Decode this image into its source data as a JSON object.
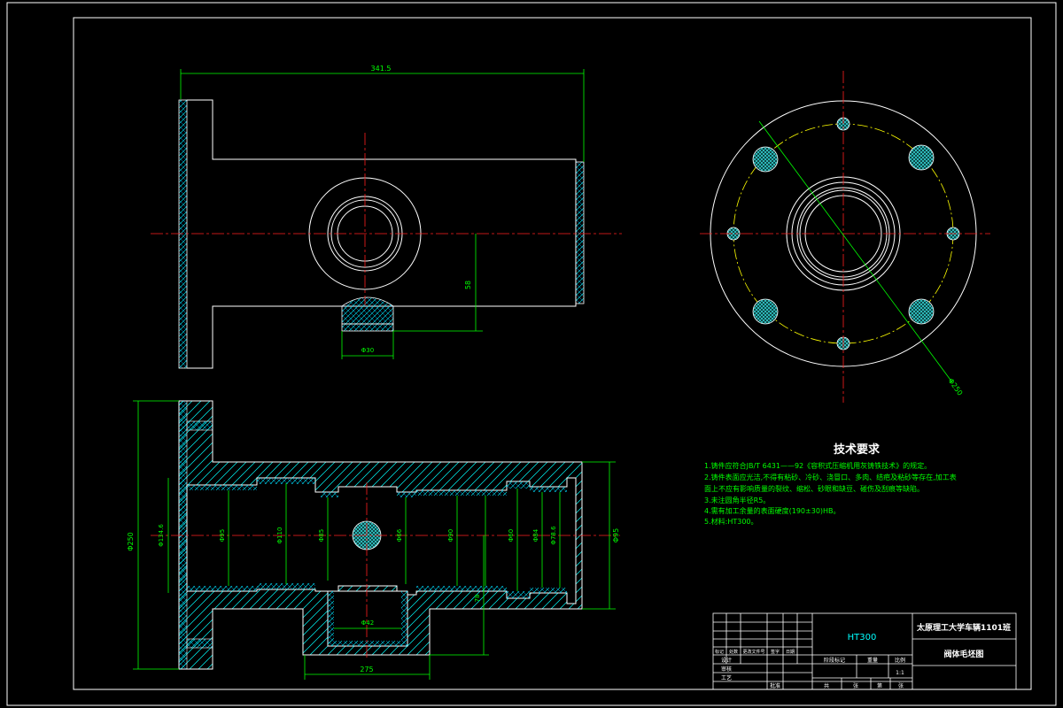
{
  "colors": {
    "background": "#000000",
    "outline": "#ffffff",
    "dimension": "#00ff00",
    "centerline": "#ff2020",
    "hatch": "#00ffff",
    "bolt_circle": "#ffff00",
    "section_fill": "#00ffff"
  },
  "top_view": {
    "dim_length": "341.5",
    "dim_height": "58",
    "dim_boss": "Φ30"
  },
  "circle_view": {
    "dim_diameter": "Φ250"
  },
  "section_view": {
    "dim_total_height": "Φ250",
    "dim_left": "Φ134.6",
    "dim_d1": "Φ95",
    "dim_d2": "Φ110",
    "dim_d3": "Φ85",
    "dim_d4": "Φ66",
    "dim_d5": "Φ90",
    "dim_d6": "Φ60",
    "dim_d7": "Φ84",
    "dim_right1": "Φ78.6",
    "dim_right2": "Φ95",
    "dim_vertical": "78",
    "dim_bottom_inner": "Φ42",
    "dim_bottom": "275"
  },
  "tech_requirements": {
    "title": "技术要求",
    "items": [
      "1.铸件应符合JB/T 6431——92《容积式压缩机用灰铸铁技术》的规定。",
      "2.铸件表面应光洁,不得有粘砂、冷砂、浇冒口、多肉、结疤及粘砂等存在,加工表",
      "面上不应有影响质量的裂纹、缩松、砂眼和缺豆、碰伤及刮痕等缺陷。",
      "3.未注圆角半径R5。",
      "4.需有加工余量的表面硬度(190±30)HB。",
      "5.材料:HT300。"
    ]
  },
  "title_block": {
    "material": "HT300",
    "school": "太原理工大学车辆1101班",
    "drawing_name": "阀体毛坯图",
    "scale": "1:1",
    "col_labels": [
      "标记",
      "处数",
      "更改文件号",
      "签字",
      "日期"
    ],
    "row_labels": [
      "设计",
      "审核",
      "工艺",
      "批准"
    ],
    "stage_labels": [
      "阶段标记",
      "重量",
      "比例"
    ],
    "sheet_labels": [
      "共",
      "张",
      "第",
      "张"
    ]
  }
}
